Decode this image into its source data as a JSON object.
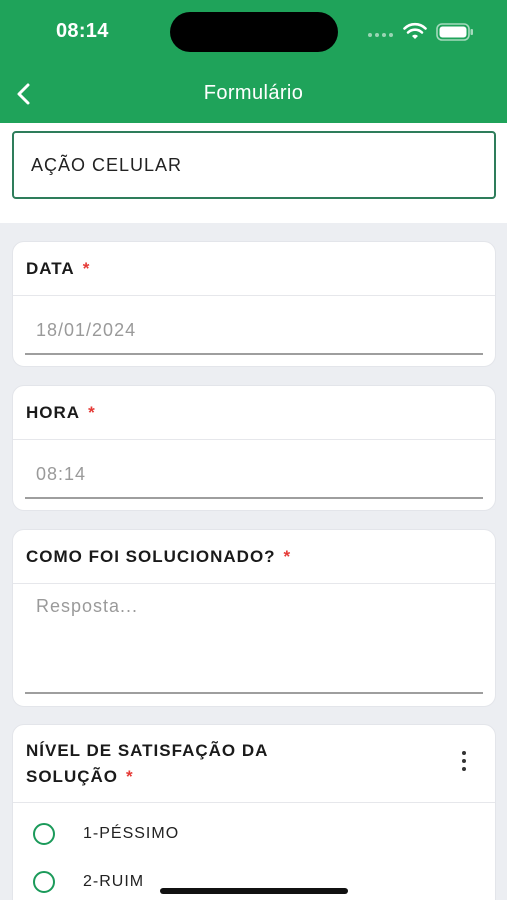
{
  "status_bar": {
    "time": "08:14"
  },
  "header": {
    "title": "Formulário",
    "back_icon": "chevron-left-icon"
  },
  "top": {
    "action": "AÇÃO CELULAR"
  },
  "fields": {
    "date": {
      "label": "DATA",
      "required": "*",
      "value": "18/01/2024"
    },
    "time": {
      "label": "HORA",
      "required": "*",
      "value": "08:14"
    },
    "solution": {
      "label": "COMO FOI SOLUCIONADO?",
      "required": "*",
      "placeholder": "Resposta..."
    },
    "satisfaction": {
      "label_line1": "NÍVEL DE SATISFAÇÃO DA",
      "label_line2": "SOLUÇÃO",
      "required": "*",
      "options": [
        "1-PÉSSIMO",
        "2-RUIM"
      ]
    }
  },
  "colors": {
    "primary": "#1fa35a",
    "required": "#e53935",
    "radio": "#1b9a5a"
  }
}
